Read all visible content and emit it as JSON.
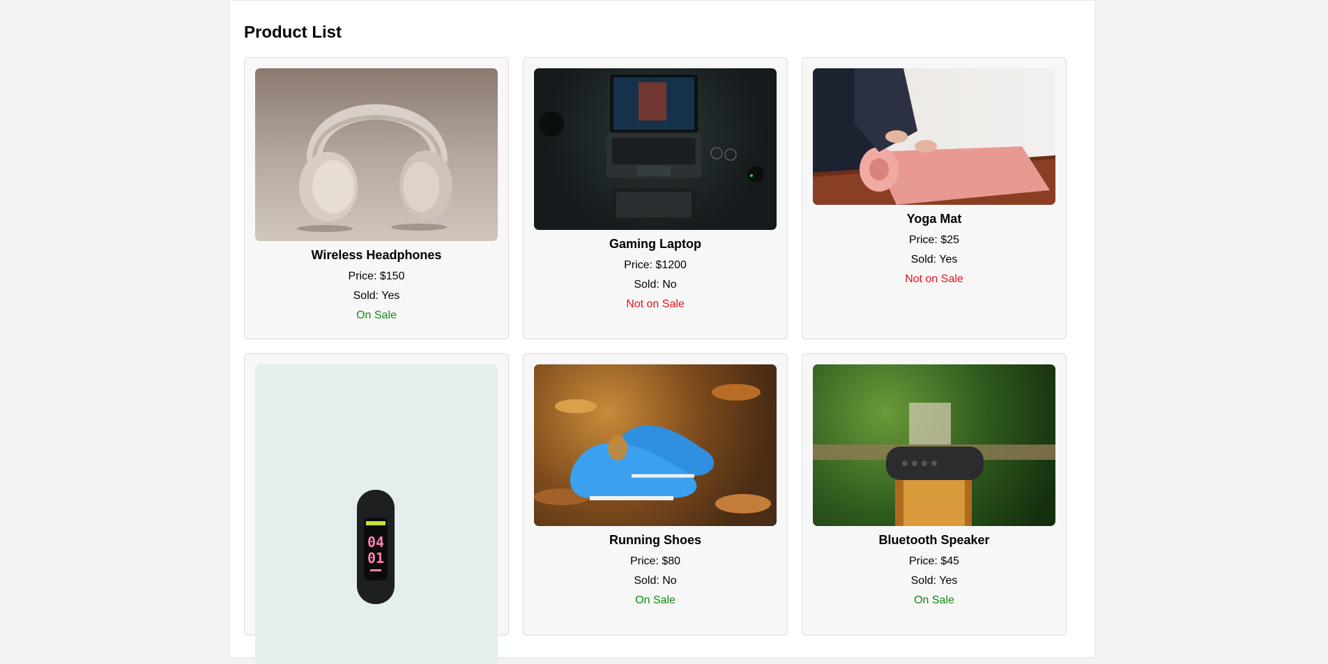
{
  "page": {
    "title": "Product List"
  },
  "colors": {
    "on_sale": "#128a12",
    "not_on_sale": "#e0121a"
  },
  "products": [
    {
      "name": "Wireless Headphones",
      "price": "Price: $150",
      "sold": "Sold: Yes",
      "status": "On Sale",
      "image_icon": "headphones-image"
    },
    {
      "name": "Gaming Laptop",
      "price": "Price: $1200",
      "sold": "Sold: No",
      "status": "Not on Sale",
      "image_icon": "laptop-image"
    },
    {
      "name": "Yoga Mat",
      "price": "Price: $25",
      "sold": "Sold: Yes",
      "status": "Not on Sale",
      "image_icon": "yoga-mat-image"
    },
    {
      "name": "",
      "price": "",
      "sold": "",
      "status": "",
      "image_icon": "fitness-band-image",
      "band_time_hour": "04",
      "band_time_min": "01"
    },
    {
      "name": "Running Shoes",
      "price": "Price: $80",
      "sold": "Sold: No",
      "status": "On Sale",
      "image_icon": "running-shoes-image"
    },
    {
      "name": "Bluetooth Speaker",
      "price": "Price: $45",
      "sold": "Sold: Yes",
      "status": "On Sale",
      "image_icon": "speaker-image"
    }
  ]
}
